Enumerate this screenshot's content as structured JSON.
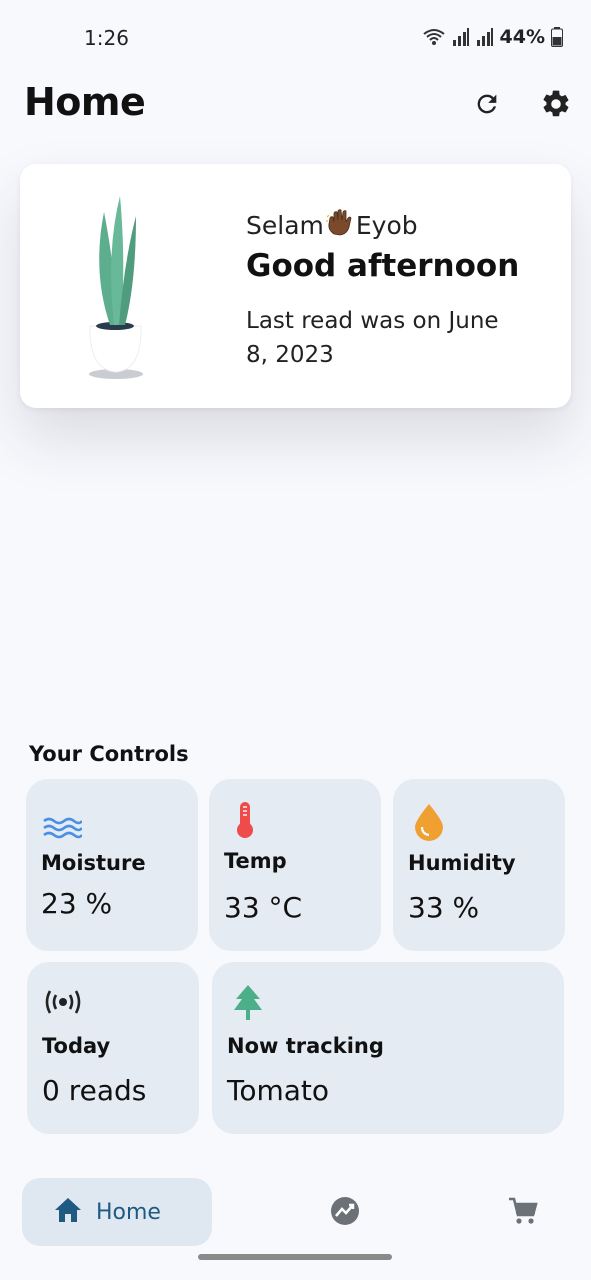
{
  "status_bar": {
    "time": "1:26",
    "battery": "44%"
  },
  "header": {
    "title": "Home",
    "refresh_icon": "refresh-icon",
    "settings_icon": "gear-icon"
  },
  "greeting": {
    "salutation": "Selam",
    "name": "Eyob",
    "message": "Good afternoon",
    "last_read": "Last read was on June 8, 2023"
  },
  "controls": {
    "section_title": "Your Controls",
    "moisture": {
      "label": "Moisture",
      "value": "23 %",
      "icon": "water-waves-icon",
      "color": "#4a90e2"
    },
    "temp": {
      "label": "Temp",
      "value": "33 °C",
      "icon": "thermometer-icon",
      "color": "#ef4b4b"
    },
    "humidity": {
      "label": "Humidity",
      "value": "33 %",
      "icon": "droplet-icon",
      "color": "#f0a030"
    },
    "today": {
      "label": "Today",
      "value": "0 reads",
      "icon": "broadcast-icon"
    },
    "tracking": {
      "label": "Now tracking",
      "value": "Tomato",
      "icon": "tree-icon",
      "color": "#4caf8a"
    }
  },
  "bottom_nav": {
    "home_label": "Home",
    "active_color": "#1e5a82",
    "items": [
      "home-icon",
      "chart-icon",
      "cart-icon"
    ]
  }
}
